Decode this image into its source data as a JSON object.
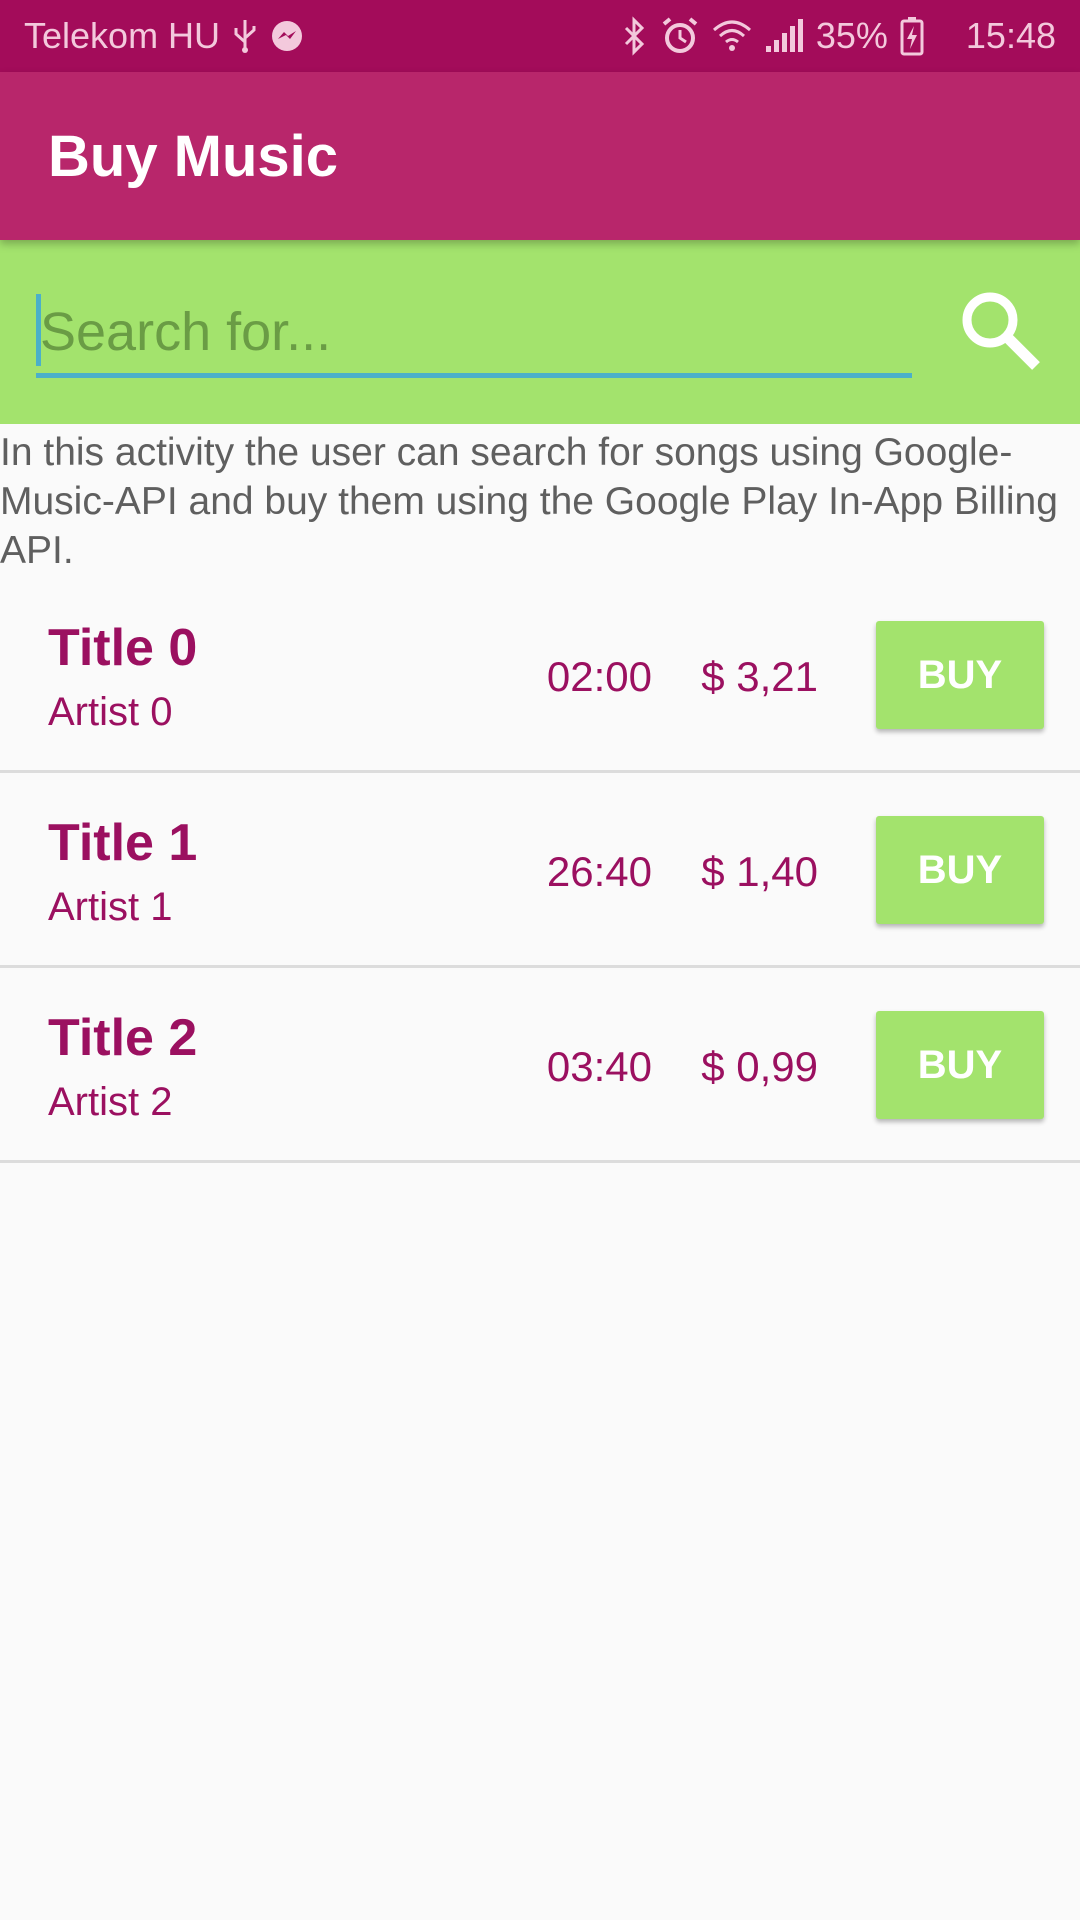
{
  "status_bar": {
    "carrier": "Telekom HU",
    "battery_percent": "35%",
    "time": "15:48",
    "icons_left": [
      "usb-icon",
      "messenger-icon"
    ],
    "icons_right": [
      "bluetooth-icon",
      "alarm-icon",
      "wifi-icon",
      "signal-icon",
      "battery-charging-icon"
    ]
  },
  "app_bar": {
    "title": "Buy Music"
  },
  "search": {
    "placeholder": "Search for...",
    "value": "",
    "button_icon": "search-icon"
  },
  "description": "In this activity the user can search for songs using Google-Music-API and buy them using the Google Play In-App Billing API.",
  "songs": [
    {
      "title": "Title 0",
      "artist": "Artist 0",
      "duration": "02:00",
      "price": "$ 3,21",
      "buy_label": "BUY"
    },
    {
      "title": "Title 1",
      "artist": "Artist 1",
      "duration": "26:40",
      "price": "$ 1,40",
      "buy_label": "BUY"
    },
    {
      "title": "Title 2",
      "artist": "Artist 2",
      "duration": "03:40",
      "price": "$ 0,99",
      "buy_label": "BUY"
    }
  ],
  "colors": {
    "status_bar": "#a30c5a",
    "app_bar": "#b8266b",
    "accent_green": "#a3e36d",
    "text_primary": "#9b1060",
    "search_underline": "#4bb0c9"
  }
}
